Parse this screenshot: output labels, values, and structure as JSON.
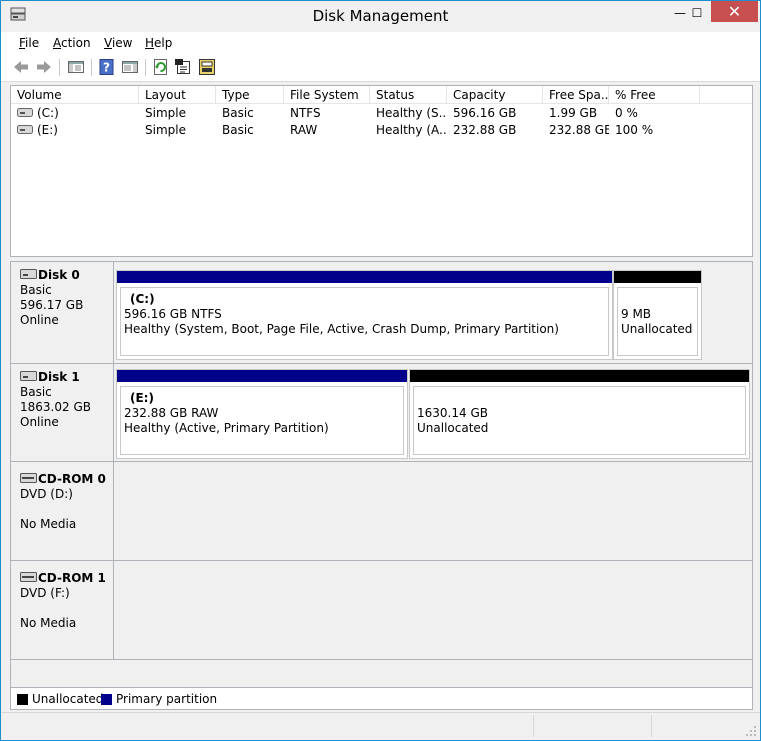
{
  "window": {
    "title": "Disk Management",
    "close_glyph": "✕",
    "min_glyph": "—",
    "max_glyph": "☐"
  },
  "menu": {
    "file": "File",
    "file_ul": "F",
    "file_rest": "ile",
    "action": "Action",
    "action_ul": "A",
    "action_rest": "ction",
    "view": "View",
    "view_ul": "V",
    "view_rest": "iew",
    "help": "Help",
    "help_ul": "H",
    "help_rest": "elp"
  },
  "toolbar": {
    "icons": [
      "back-arrow-icon",
      "forward-arrow-icon",
      "console-tree-icon",
      "help-icon",
      "details-pane-icon",
      "refresh-icon",
      "properties-icon",
      "rescan-disks-icon"
    ]
  },
  "volumes": {
    "headers": [
      "Volume",
      "Layout",
      "Type",
      "File System",
      "Status",
      "Capacity",
      "Free Spa...",
      "% Free"
    ],
    "rows": [
      {
        "volume": "(C:)",
        "layout": "Simple",
        "type": "Basic",
        "fs": "NTFS",
        "status": "Healthy (S...",
        "capacity": "596.16 GB",
        "free": "1.99 GB",
        "pct": "0 %"
      },
      {
        "volume": "(E:)",
        "layout": "Simple",
        "type": "Basic",
        "fs": "RAW",
        "status": "Healthy (A...",
        "capacity": "232.88 GB",
        "free": "232.88 GB",
        "pct": "100 %"
      }
    ]
  },
  "disks": [
    {
      "name": "Disk 0",
      "line1": "Basic",
      "line2": "596.17 GB",
      "line3": "Online",
      "partitions": [
        {
          "name": "(C:)",
          "line1": "596.16 GB NTFS",
          "line2": "Healthy (System, Boot, Page File, Active, Crash Dump, Primary Partition)",
          "kind": "primary"
        },
        {
          "name": "",
          "line1": "9 MB",
          "line2": "Unallocated",
          "kind": "unallocated"
        }
      ]
    },
    {
      "name": "Disk 1",
      "line1": "Basic",
      "line2": "1863.02 GB",
      "line3": "Online",
      "partitions": [
        {
          "name": "(E:)",
          "line1": "232.88 GB RAW",
          "line2": "Healthy (Active, Primary Partition)",
          "kind": "primary"
        },
        {
          "name": "",
          "line1": "1630.14 GB",
          "line2": "Unallocated",
          "kind": "unallocated"
        }
      ]
    },
    {
      "name": "CD-ROM 0",
      "line1": "DVD (D:)",
      "line2": "",
      "line3": "No Media"
    },
    {
      "name": "CD-ROM 1",
      "line1": "DVD (F:)",
      "line2": "",
      "line3": "No Media"
    }
  ],
  "legend": {
    "unallocated": "Unallocated",
    "primary": "Primary partition"
  },
  "colors": {
    "primary": "#00008b",
    "unallocated": "#000000",
    "close": "#c74f50",
    "frame": "#1f8ecd"
  }
}
